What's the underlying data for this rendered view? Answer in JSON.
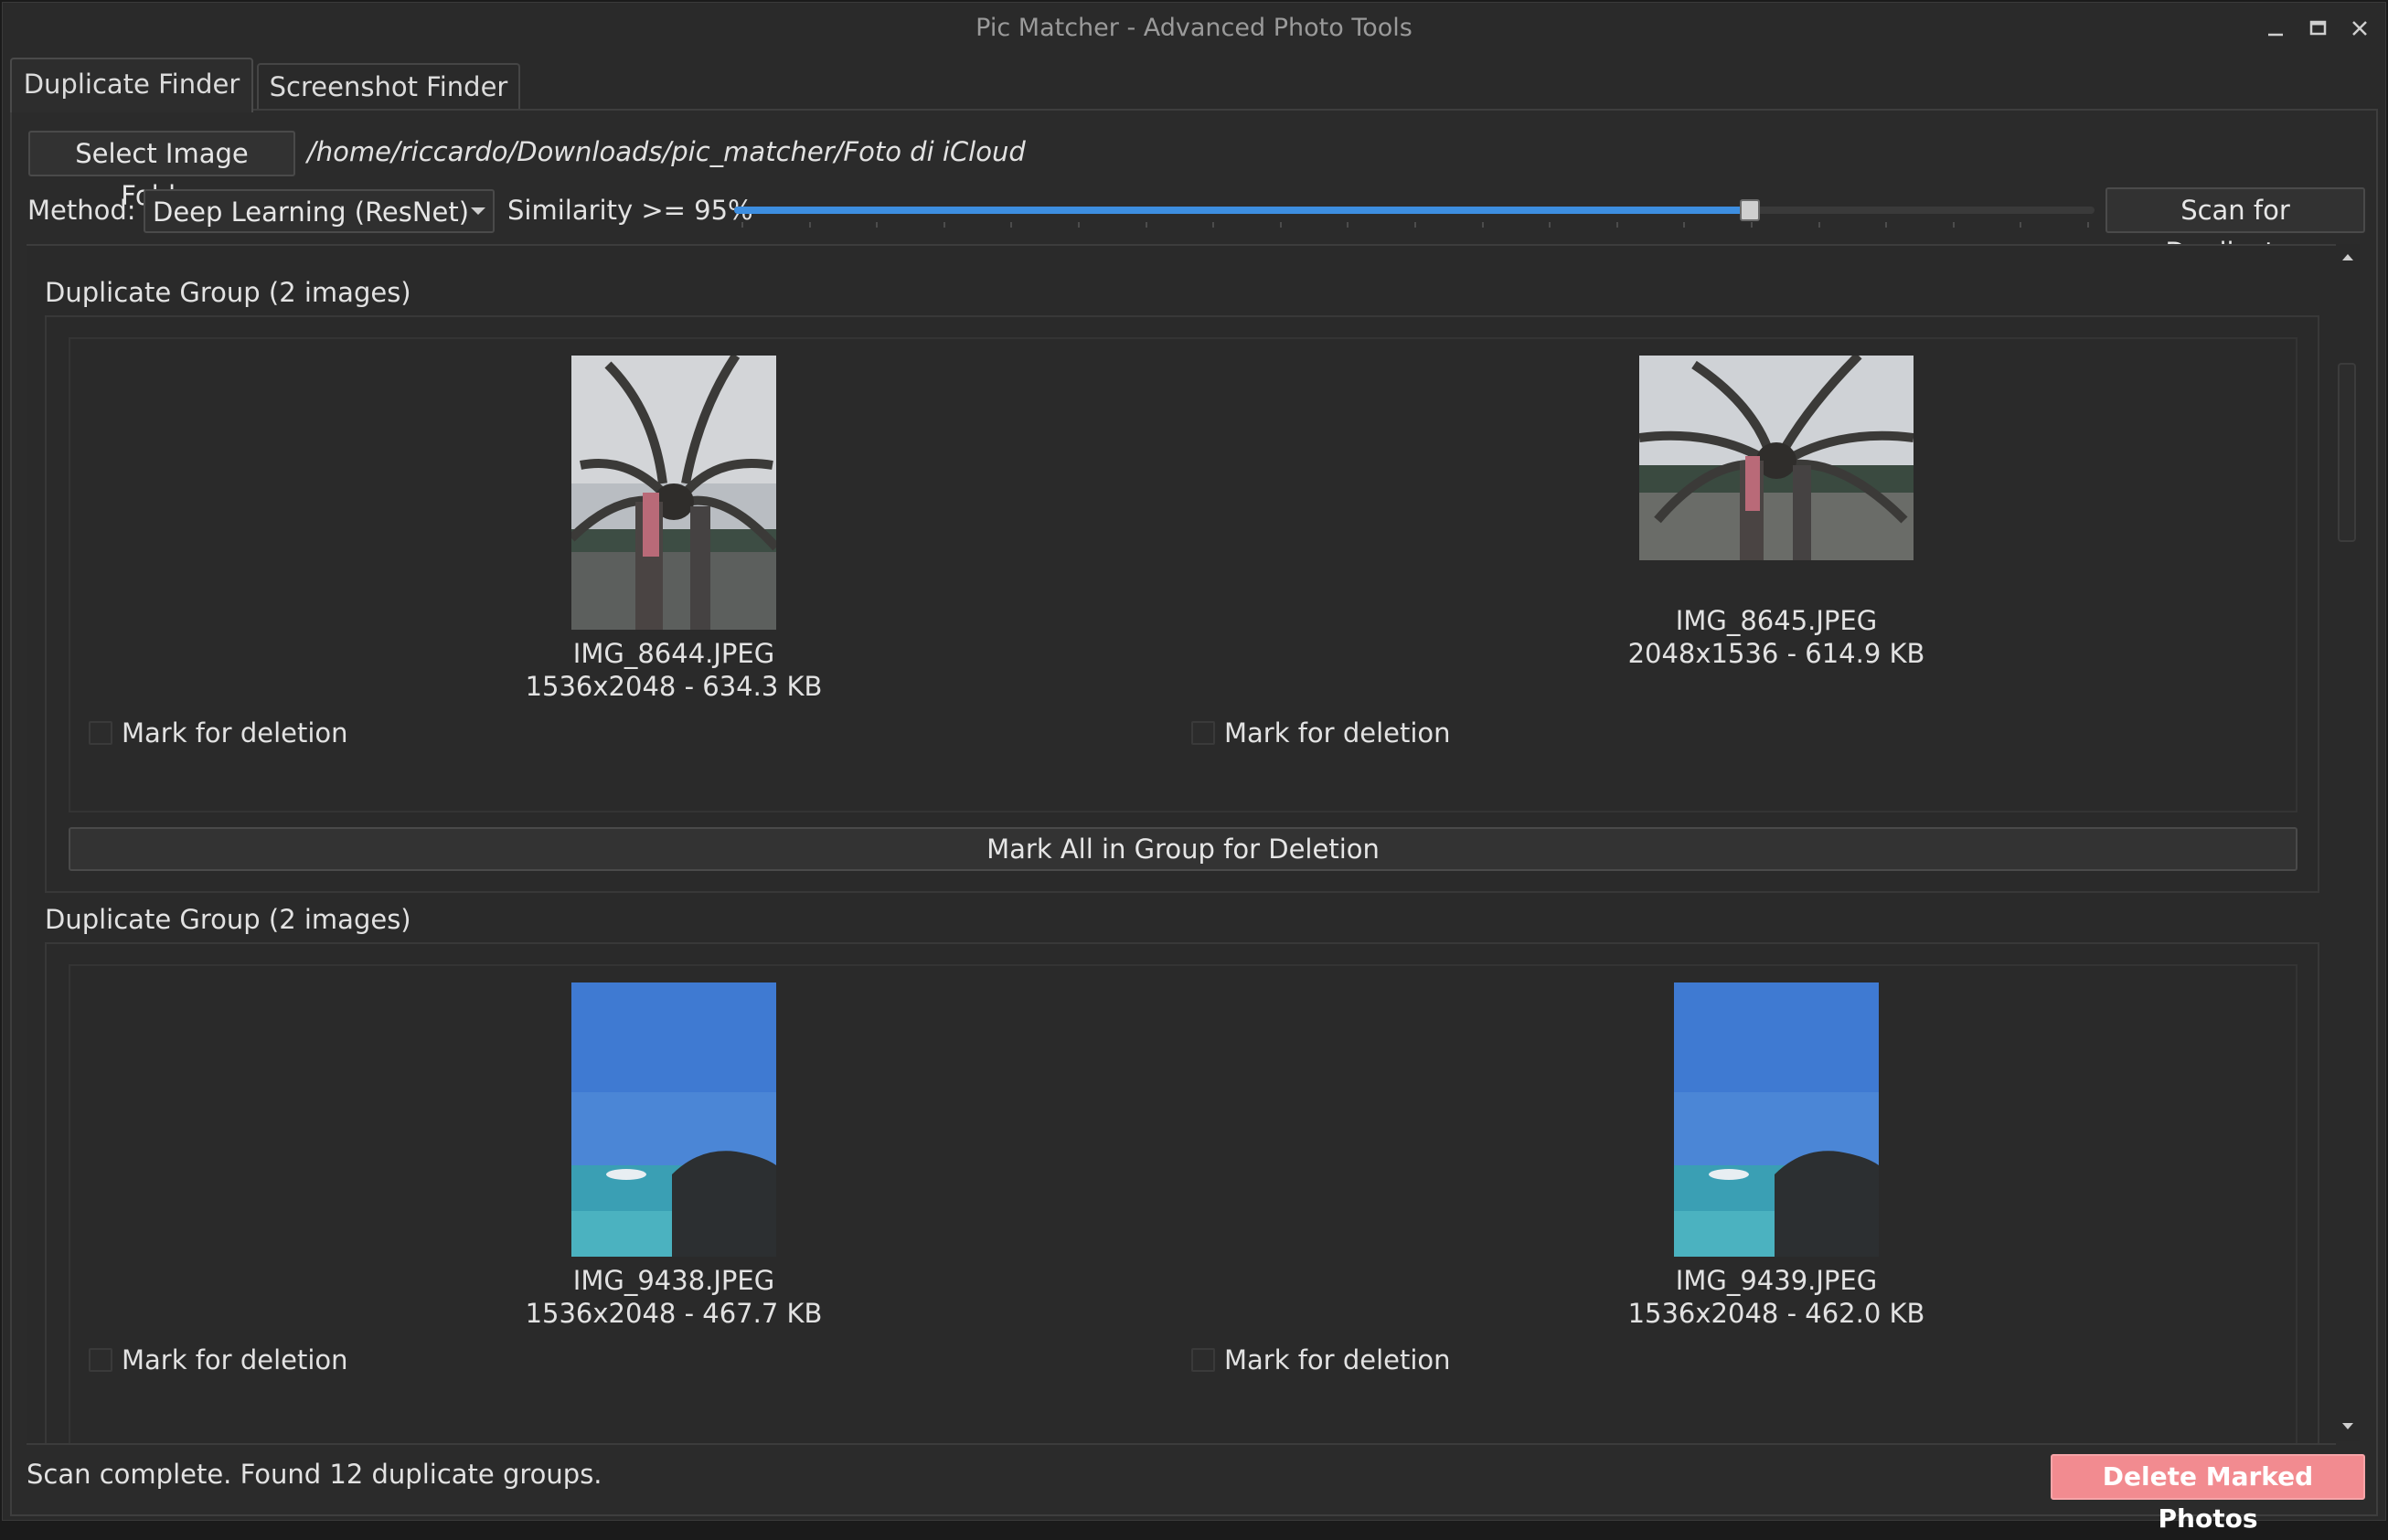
{
  "window": {
    "title": "Pic Matcher - Advanced Photo Tools"
  },
  "tabs": [
    {
      "label": "Duplicate Finder",
      "active": true
    },
    {
      "label": "Screenshot Finder",
      "active": false
    }
  ],
  "toolbar": {
    "select_folder_label": "Select Image Folder",
    "folder_path": "/home/riccardo/Downloads/pic_matcher/Foto di iCloud",
    "method_label": "Method:",
    "method_value": "Deep Learning (ResNet)",
    "similarity_label": "Similarity >= 95%",
    "similarity_value": 95,
    "scan_label": "Scan for Duplicates"
  },
  "groups": [
    {
      "title": "Duplicate Group (2 images)",
      "images": [
        {
          "name": "IMG_8644.JPEG",
          "info": "1536x2048 - 634.3 KB",
          "checkbox_label": "Mark for deletion",
          "checked": false,
          "thumb": "spider-portrait"
        },
        {
          "name": "IMG_8645.JPEG",
          "info": "2048x1536 - 614.9 KB",
          "checkbox_label": "Mark for deletion",
          "checked": false,
          "thumb": "spider-landscape"
        }
      ],
      "mark_all_label": "Mark All in Group for Deletion"
    },
    {
      "title": "Duplicate Group (2 images)",
      "images": [
        {
          "name": "IMG_9438.JPEG",
          "info": "1536x2048 - 467.7 KB",
          "checkbox_label": "Mark for deletion",
          "checked": false,
          "thumb": "sea-portrait"
        },
        {
          "name": "IMG_9439.JPEG",
          "info": "1536x2048 - 462.0 KB",
          "checkbox_label": "Mark for deletion",
          "checked": false,
          "thumb": "sea-portrait"
        }
      ]
    }
  ],
  "status": {
    "message": "Scan complete. Found 12 duplicate groups.",
    "delete_label": "Delete Marked Photos"
  },
  "colors": {
    "accent": "#3d8ee0",
    "danger": "#f28b90",
    "background": "#2a2a2a"
  }
}
